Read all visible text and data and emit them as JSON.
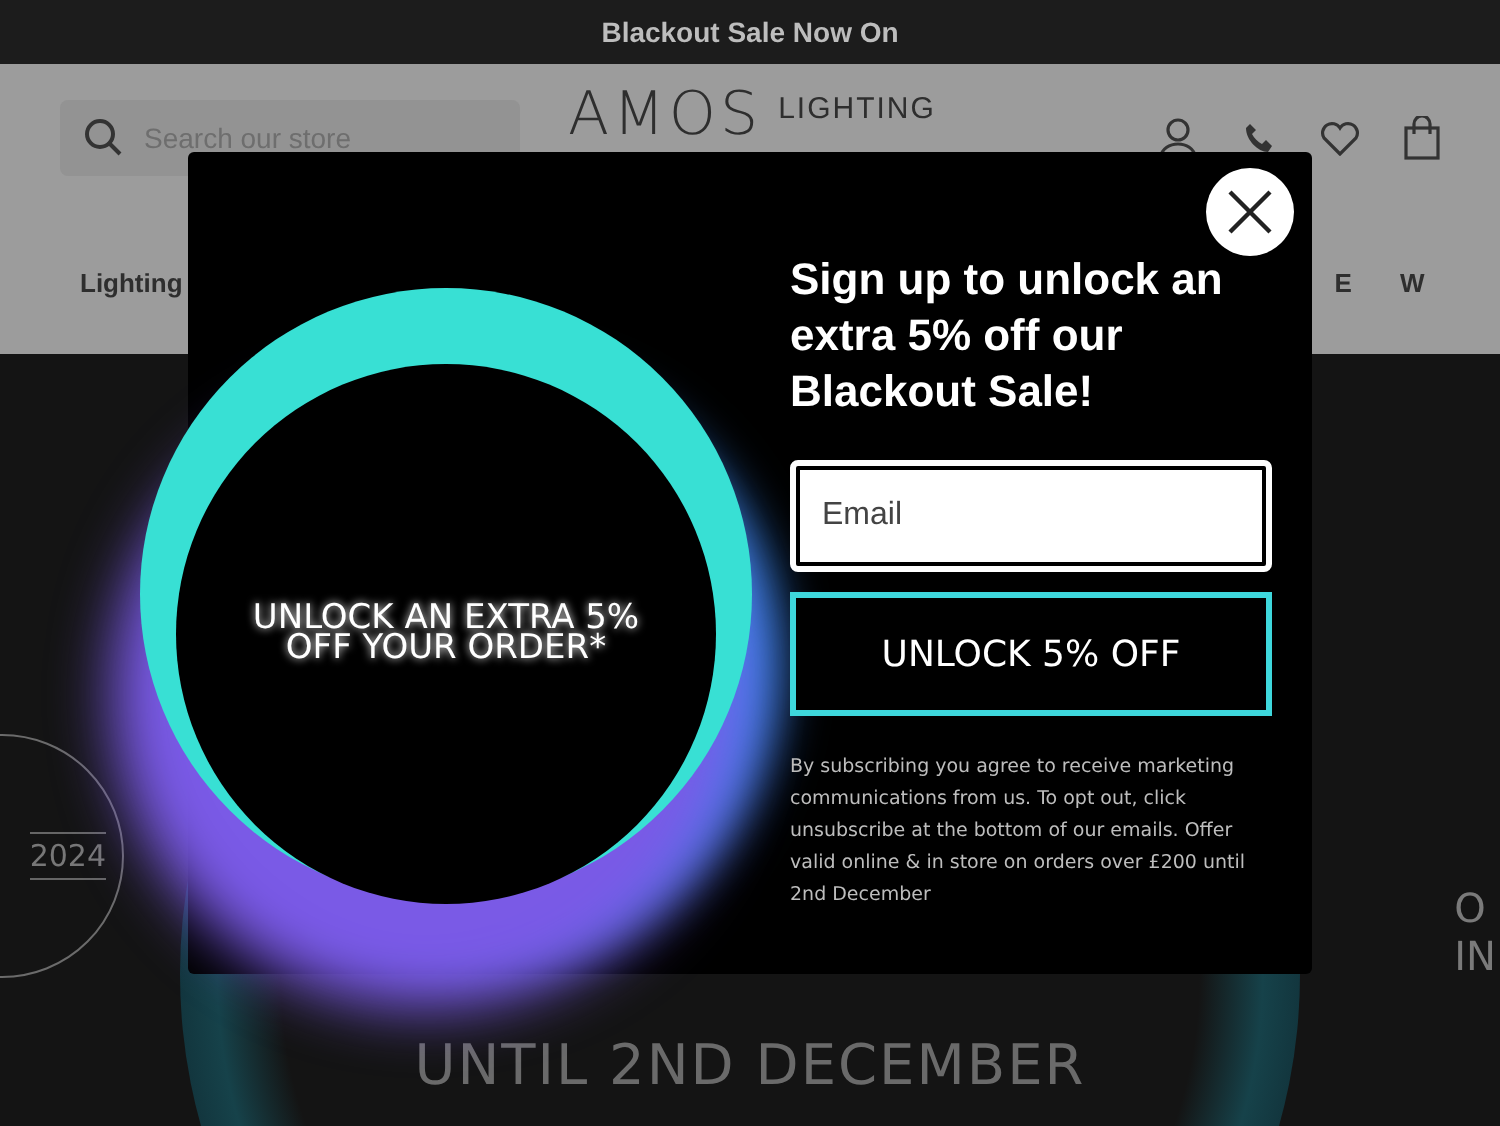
{
  "announcement": "Blackout Sale Now On",
  "header": {
    "search": {
      "placeholder": "Search our store"
    },
    "logo": {
      "name": "AMOS",
      "tagline": "LIGHTING"
    },
    "nav": [
      "Lighting",
      "E",
      "W"
    ]
  },
  "hero": {
    "badge_year": "2024",
    "side_text": [
      "O",
      "IN"
    ],
    "subtitle": "UNTIL 2ND DECEMBER"
  },
  "popup": {
    "image_text": [
      "UNLOCK AN EXTRA 5%",
      "OFF YOUR ORDER*"
    ],
    "heading": "Sign up to unlock an extra 5% off our Blackout Sale!",
    "email": {
      "placeholder": "Email"
    },
    "button": "UNLOCK 5% OFF",
    "disclaimer": "By subscribing you agree to receive marketing communications from us. To opt out, click unsubscribe at the bottom of our emails. Offer valid online & in store on orders over £200 until 2nd December"
  }
}
